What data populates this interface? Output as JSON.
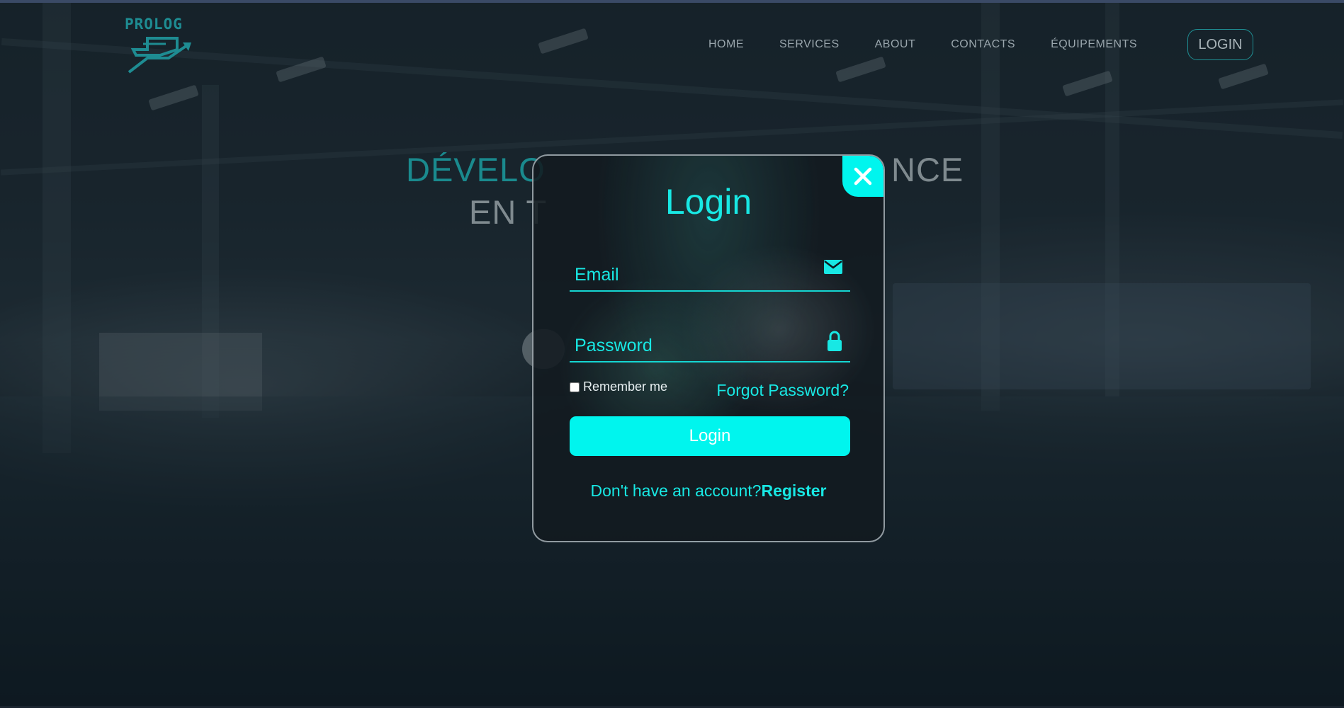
{
  "brand": {
    "logo_text": "PROLOG",
    "accent": "#00f5ee",
    "teal": "#1a8a8e"
  },
  "nav": {
    "items": [
      {
        "label": "HOME"
      },
      {
        "label": "SERVICES"
      },
      {
        "label": "ABOUT"
      },
      {
        "label": "CONTACTS"
      },
      {
        "label": "ÉQUIPEMENTS"
      }
    ],
    "login_button": "LOGIN"
  },
  "hero": {
    "line1_start": "DÉVELO",
    "line1_end": "NCE",
    "line2_start": "EN T"
  },
  "modal": {
    "title": "Login",
    "close_icon": "close-icon",
    "email": {
      "placeholder": "Email",
      "value": "",
      "icon": "mail-icon"
    },
    "password": {
      "placeholder": "Password",
      "value": "",
      "icon": "lock-icon"
    },
    "remember_label": "Remember me",
    "remember_checked": false,
    "forgot_label": "Forgot Password?",
    "submit_label": "Login",
    "register_prompt": "Don't have an account?",
    "register_link": "Register"
  }
}
